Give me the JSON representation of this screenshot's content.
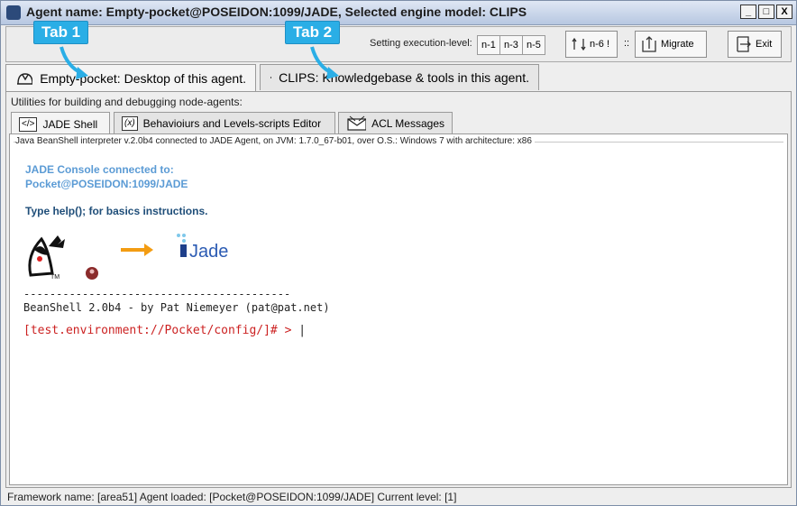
{
  "window": {
    "title": "Agent name: Empty-pocket@POSEIDON:1099/JADE, Selected engine model: CLIPS",
    "controls": [
      "_",
      "□",
      "X"
    ]
  },
  "toolbar": {
    "exec_label": "Setting execution-level:",
    "n1": "n-1",
    "n3": "n-3",
    "n5": "n-5",
    "n6": "n-6 !",
    "sep": "::",
    "migrate": "Migrate",
    "exit": "Exit"
  },
  "callouts": {
    "tab1": "Tab 1",
    "tab2": "Tab 2"
  },
  "main_tabs": [
    {
      "label": "Empty-pocket: Desktop of this agent.",
      "icon": "helmet-icon"
    },
    {
      "label": "CLIPS: Knowledgebase & tools in this agent.",
      "icon": "gear-icon"
    }
  ],
  "utilities_label": "Utilities for building and debugging node-agents:",
  "sub_tabs": [
    {
      "label": "JADE Shell",
      "icon_text": "</>"
    },
    {
      "label": "Behavioiurs and Levels-scripts Editor",
      "icon_text": "(x)"
    },
    {
      "label": "ACL Messages",
      "icon": "envelope-icon"
    }
  ],
  "group_title": "Java BeanShell interpreter v.2.0b4 connected to JADE Agent, on JVM: 1.7.0_67-b01, over O.S.: Windows 7 with architecture: x86",
  "console": {
    "line1": "JADE Console connected to:",
    "line2": "Pocket@POSEIDON:1099/JADE",
    "line3": "Type help(); for basics instructions.",
    "jade_logo_text": "Jade",
    "tm": "TM",
    "dashes": "-----------------------------------------",
    "beanshell": "BeanShell 2.0b4 - by Pat Niemeyer (pat@pat.net)",
    "prompt": "[test.environment://Pocket/config/]# > ",
    "cursor": "|"
  },
  "status": "Framework name: [area51] Agent loaded: [Pocket@POSEIDON:1099/JADE] Current level: [1]",
  "colors": {
    "callout": "#2aaee6",
    "console_blue": "#5b9bd5",
    "prompt_red": "#cc2222",
    "arrow_orange": "#f39c12"
  }
}
